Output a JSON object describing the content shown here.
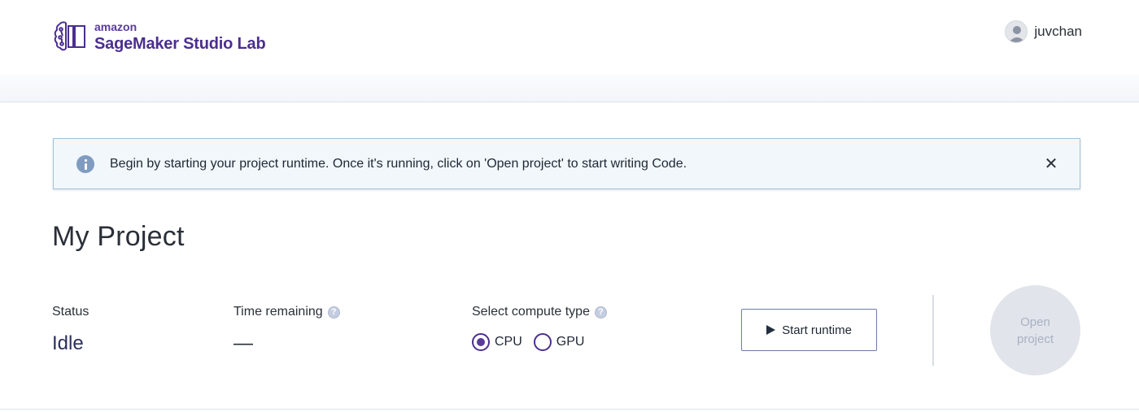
{
  "brand": {
    "amazon": "amazon",
    "product": "SageMaker Studio Lab",
    "color": "#4b2f8f"
  },
  "user": {
    "name": "juvchan",
    "avatar_icon": "user-avatar-icon"
  },
  "alert": {
    "icon": "info-icon",
    "message": "Begin by starting your project runtime. Once it's running, click on 'Open project' to start writing Code.",
    "close_icon": "close-icon",
    "close_label": "✕"
  },
  "project": {
    "title": "My Project",
    "status_label": "Status",
    "status_value": "Idle",
    "time_label": "Time remaining",
    "time_value": "—",
    "compute_label": "Select compute type",
    "compute_options": [
      {
        "label": "CPU",
        "selected": true
      },
      {
        "label": "GPU",
        "selected": false
      }
    ],
    "start_button": "Start runtime",
    "open_button_line1": "Open",
    "open_button_line2": "project",
    "open_button_enabled": false
  },
  "colors": {
    "accent": "#5a3b9a",
    "alert_bg": "#f1f7fb",
    "alert_border": "#9fc3dc",
    "disabled": "#e1e4ea"
  }
}
